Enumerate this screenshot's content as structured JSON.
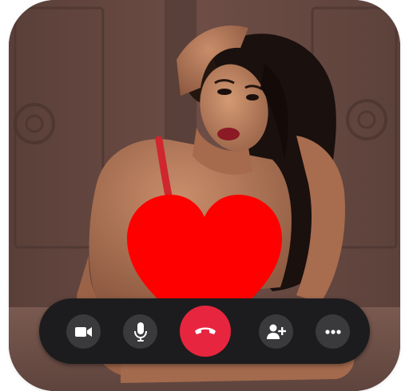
{
  "call": {
    "state": "in-call",
    "reaction": "heart",
    "colors": {
      "reaction_heart": "#ff0000",
      "control_bar": "#1c1c1e",
      "control_button": "#3a3a3c",
      "end_call": "#e8253f",
      "icon": "#ffffff"
    }
  },
  "controls": [
    {
      "id": "video",
      "icon": "video-camera-icon"
    },
    {
      "id": "mic",
      "icon": "microphone-icon"
    },
    {
      "id": "end",
      "icon": "end-call-icon"
    },
    {
      "id": "add_person",
      "icon": "add-person-icon"
    },
    {
      "id": "more",
      "icon": "more-options-icon"
    }
  ]
}
